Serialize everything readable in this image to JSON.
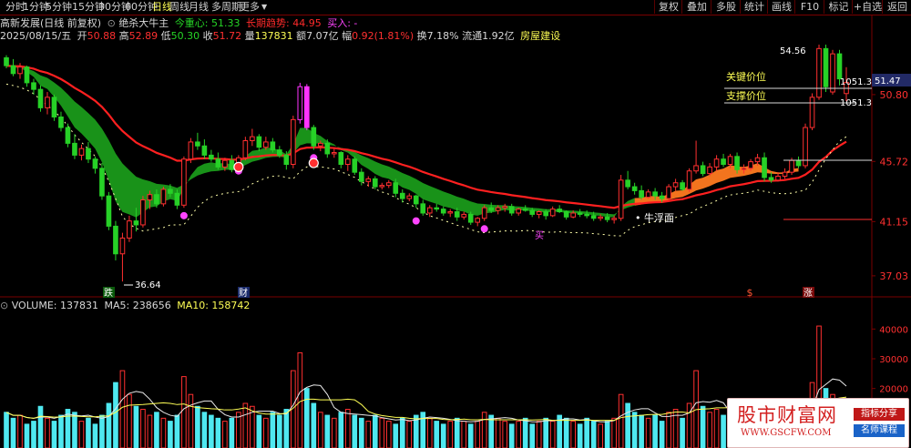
{
  "colors": {
    "up": "#ff3030",
    "down": "#27d127",
    "pink": "#ff33ff",
    "cloud": "#1a9a1a",
    "orange": "#ff7a20",
    "redLine": "#ff2020",
    "cyan": "#4fe8f0",
    "yellow": "#ffff55"
  },
  "topbar": {
    "tabs": [
      "分时",
      "1分钟",
      "5分钟",
      "15分钟",
      "30分钟",
      "60分钟",
      "日线",
      "周线",
      "月线",
      "多周期",
      "更多"
    ],
    "active_tab": "日线",
    "more_icon": "caret-down-icon",
    "right_buttons": [
      "复权",
      "叠加",
      "多股",
      "统计",
      "画线",
      "F10",
      "标记",
      "+自选",
      "返回"
    ]
  },
  "info": {
    "stock_name": "高新发展(日线 前复权)",
    "indicator_name": "绝杀大牛主",
    "today_center_label": "今重心: ",
    "today_center": "51.33",
    "long_trend_label": "长期趋势: ",
    "long_trend": "44.95",
    "buy_label": "买入: ",
    "buy_value": "-",
    "date": "2025/08/15/五",
    "open_label": "开",
    "open": "50.88",
    "high_label": "高",
    "high": "52.89",
    "low_label": "低",
    "low": "50.30",
    "close_label": "收",
    "close": "51.72",
    "volume_label": "量",
    "volume": "137831",
    "amount_label": "额",
    "amount": "7.07亿",
    "change_label": "幅",
    "change": "0.92(1.81%)",
    "turnover_label": "换",
    "turnover": "7.18%",
    "float_label": "流通",
    "float": "1.92亿",
    "sector": "房屋建设"
  },
  "price_axis": {
    "labels": [
      "50.80",
      "45.72",
      "41.15",
      "37.03"
    ],
    "current_price": "51.47"
  },
  "annotations": {
    "key_price": "关键价位",
    "support_price": "支撑价位",
    "key_value": "1051.3",
    "support_value": "1051.3",
    "niufu": "牛浮面",
    "high_mark": "54.56",
    "low_mark": "36.64",
    "mark_die": "跌",
    "mark_cai": "财",
    "mark_dollar": "$",
    "mark_zhang": "涨",
    "mark_mai": "买"
  },
  "volume": {
    "title": "VOLUME: ",
    "value": "137831",
    "ma5_label": "MA5: ",
    "ma5": "238656",
    "ma10_label": "MA10: ",
    "ma10": "158742",
    "axis_labels": [
      "40000",
      "30000",
      "20000"
    ]
  },
  "watermark": {
    "title": "股市财富网",
    "url": "WWW.GSCFW.COM",
    "badge1": "指标分享",
    "badge2": "名师课程"
  },
  "chart_data": {
    "type": "candlestick",
    "ylim": [
      35.5,
      55.5
    ],
    "yticks": [
      50.8,
      45.72,
      41.15,
      37.03
    ],
    "ohlc": [
      [
        53.6,
        53.8,
        52.8,
        53.0
      ],
      [
        53.0,
        53.5,
        52.2,
        52.4
      ],
      [
        52.4,
        53.2,
        52.0,
        52.9
      ],
      [
        52.9,
        53.0,
        51.4,
        51.7
      ],
      [
        51.7,
        52.0,
        50.8,
        51.2
      ],
      [
        51.2,
        51.5,
        49.5,
        49.8
      ],
      [
        49.8,
        51.0,
        49.3,
        50.6
      ],
      [
        50.6,
        50.8,
        48.8,
        49.1
      ],
      [
        49.1,
        49.5,
        48.0,
        48.3
      ],
      [
        48.3,
        48.6,
        46.8,
        47.1
      ],
      [
        47.1,
        47.8,
        45.9,
        46.2
      ],
      [
        46.2,
        47.0,
        45.8,
        46.7
      ],
      [
        46.7,
        47.2,
        45.6,
        45.9
      ],
      [
        45.9,
        46.1,
        44.8,
        45.2
      ],
      [
        45.2,
        45.6,
        42.8,
        43.1
      ],
      [
        43.1,
        43.4,
        40.5,
        40.8
      ],
      [
        40.8,
        41.2,
        38.2,
        38.7
      ],
      [
        38.7,
        40.3,
        36.6,
        39.9
      ],
      [
        39.9,
        41.6,
        39.6,
        41.2
      ],
      [
        41.2,
        42.2,
        40.4,
        40.9
      ],
      [
        40.9,
        43.1,
        40.7,
        42.8
      ],
      [
        42.8,
        43.5,
        42.1,
        43.2
      ],
      [
        43.2,
        43.6,
        42.2,
        42.5
      ],
      [
        42.5,
        43.8,
        42.3,
        43.6
      ],
      [
        43.6,
        44.0,
        43.0,
        43.3
      ],
      [
        43.3,
        43.6,
        42.1,
        42.4
      ],
      [
        42.4,
        46.1,
        42.2,
        45.9
      ],
      [
        45.9,
        47.5,
        45.6,
        47.2
      ],
      [
        47.2,
        47.9,
        46.6,
        46.9
      ],
      [
        46.9,
        47.4,
        45.9,
        46.2
      ],
      [
        46.2,
        46.6,
        45.7,
        45.9
      ],
      [
        45.9,
        46.4,
        45.1,
        45.3
      ],
      [
        45.3,
        46.0,
        45.0,
        45.8
      ],
      [
        45.8,
        46.2,
        44.9,
        45.1
      ],
      [
        45.1,
        46.2,
        44.9,
        46.0
      ],
      [
        46.0,
        47.6,
        45.8,
        47.3
      ],
      [
        47.3,
        48.2,
        46.9,
        47.6
      ],
      [
        47.6,
        47.8,
        46.5,
        46.8
      ],
      [
        46.8,
        47.6,
        46.6,
        47.2
      ],
      [
        47.2,
        47.5,
        46.4,
        46.6
      ],
      [
        46.6,
        46.9,
        46.0,
        46.2
      ],
      [
        46.2,
        46.5,
        45.1,
        45.5
      ],
      [
        45.5,
        49.2,
        45.2,
        48.9
      ],
      [
        48.9,
        51.7,
        48.6,
        51.4
      ],
      [
        51.4,
        51.6,
        48.1,
        48.3
      ],
      [
        48.3,
        48.5,
        46.6,
        46.9
      ],
      [
        46.9,
        47.3,
        46.5,
        47.1
      ],
      [
        47.1,
        47.4,
        46.0,
        46.3
      ],
      [
        46.3,
        46.7,
        46.0,
        46.4
      ],
      [
        46.4,
        46.5,
        45.2,
        45.5
      ],
      [
        45.5,
        46.2,
        45.0,
        45.9
      ],
      [
        45.9,
        46.1,
        44.7,
        44.9
      ],
      [
        44.9,
        45.2,
        43.9,
        44.2
      ],
      [
        44.2,
        44.6,
        43.8,
        44.4
      ],
      [
        44.4,
        44.6,
        43.6,
        43.8
      ],
      [
        43.8,
        44.1,
        43.6,
        43.9
      ],
      [
        43.9,
        44.3,
        43.7,
        44.1
      ],
      [
        44.1,
        44.4,
        43.0,
        43.3
      ],
      [
        43.3,
        43.6,
        42.6,
        42.9
      ],
      [
        42.9,
        43.3,
        42.7,
        43.1
      ],
      [
        43.1,
        43.2,
        42.2,
        42.5
      ],
      [
        42.5,
        42.8,
        41.6,
        41.8
      ],
      [
        41.8,
        42.4,
        41.5,
        42.2
      ],
      [
        42.2,
        42.5,
        41.9,
        42.1
      ],
      [
        42.1,
        42.3,
        41.6,
        41.8
      ],
      [
        41.8,
        42.1,
        41.5,
        41.9
      ],
      [
        41.9,
        42.2,
        41.2,
        41.5
      ],
      [
        41.5,
        41.9,
        41.3,
        41.7
      ],
      [
        41.7,
        41.9,
        40.9,
        41.1
      ],
      [
        41.1,
        41.5,
        40.8,
        41.4
      ],
      [
        41.4,
        42.4,
        41.2,
        42.2
      ],
      [
        42.2,
        42.6,
        41.8,
        42.0
      ],
      [
        42.0,
        42.4,
        41.7,
        42.2
      ],
      [
        42.2,
        42.5,
        41.9,
        42.3
      ],
      [
        42.3,
        42.5,
        41.6,
        41.8
      ],
      [
        41.8,
        42.2,
        41.6,
        42.1
      ],
      [
        42.1,
        42.4,
        41.9,
        42.0
      ],
      [
        42.0,
        42.2,
        41.5,
        41.7
      ],
      [
        41.7,
        42.0,
        41.4,
        41.9
      ],
      [
        41.9,
        42.1,
        41.3,
        41.6
      ],
      [
        41.6,
        42.3,
        41.5,
        42.1
      ],
      [
        42.1,
        42.4,
        41.8,
        41.9
      ],
      [
        41.9,
        42.0,
        41.3,
        41.5
      ],
      [
        41.5,
        42.0,
        41.4,
        41.8
      ],
      [
        41.8,
        42.1,
        41.5,
        41.7
      ],
      [
        41.7,
        42.0,
        41.4,
        41.6
      ],
      [
        41.6,
        41.9,
        41.2,
        41.4
      ],
      [
        41.4,
        41.7,
        41.2,
        41.5
      ],
      [
        41.5,
        41.8,
        41.1,
        41.3
      ],
      [
        41.3,
        41.6,
        41.0,
        41.4
      ],
      [
        41.4,
        44.7,
        41.2,
        44.3
      ],
      [
        44.3,
        45.0,
        43.6,
        43.8
      ],
      [
        43.8,
        44.1,
        43.2,
        43.5
      ],
      [
        43.5,
        43.9,
        42.8,
        43.0
      ],
      [
        43.0,
        43.6,
        42.9,
        43.4
      ],
      [
        43.4,
        43.7,
        42.8,
        43.1
      ],
      [
        43.1,
        43.4,
        42.6,
        42.9
      ],
      [
        42.9,
        44.0,
        42.8,
        43.8
      ],
      [
        43.8,
        44.4,
        43.5,
        44.1
      ],
      [
        44.1,
        44.3,
        43.5,
        43.6
      ],
      [
        43.6,
        45.2,
        43.4,
        45.0
      ],
      [
        45.0,
        47.3,
        44.8,
        45.4
      ],
      [
        45.4,
        45.7,
        44.6,
        44.8
      ],
      [
        44.8,
        45.6,
        44.6,
        45.3
      ],
      [
        45.3,
        46.2,
        45.0,
        45.9
      ],
      [
        45.9,
        46.3,
        45.3,
        45.5
      ],
      [
        45.5,
        46.3,
        45.2,
        46.1
      ],
      [
        46.1,
        46.4,
        44.8,
        45.1
      ],
      [
        45.1,
        45.5,
        44.8,
        45.2
      ],
      [
        45.2,
        45.9,
        45.0,
        45.7
      ],
      [
        45.7,
        46.3,
        45.4,
        46.0
      ],
      [
        46.0,
        46.4,
        44.2,
        44.5
      ],
      [
        44.5,
        44.9,
        44.1,
        44.3
      ],
      [
        44.3,
        44.9,
        44.2,
        44.6
      ],
      [
        44.6,
        45.2,
        44.4,
        44.9
      ],
      [
        44.9,
        46.0,
        44.7,
        45.8
      ],
      [
        45.8,
        46.1,
        45.2,
        45.4
      ],
      [
        45.4,
        48.6,
        45.2,
        48.3
      ],
      [
        48.3,
        50.9,
        48.1,
        50.6
      ],
      [
        50.6,
        54.6,
        50.4,
        54.3
      ],
      [
        54.3,
        54.6,
        51.0,
        51.4
      ],
      [
        51.0,
        54.2,
        50.8,
        53.9
      ],
      [
        53.9,
        54.2,
        51.5,
        52.0
      ],
      [
        50.88,
        52.89,
        50.3,
        51.72
      ]
    ],
    "volume": [
      12,
      10,
      11,
      8,
      9,
      14,
      10,
      9,
      11,
      13,
      12,
      9,
      10,
      8,
      11,
      15,
      22,
      26,
      18,
      14,
      13,
      11,
      12,
      10,
      9,
      11,
      24,
      18,
      14,
      12,
      11,
      10,
      9,
      10,
      12,
      15,
      14,
      11,
      10,
      12,
      11,
      13,
      26,
      32,
      20,
      15,
      12,
      11,
      10,
      12,
      13,
      11,
      10,
      9,
      11,
      10,
      9,
      8,
      10,
      9,
      11,
      12,
      10,
      9,
      8,
      9,
      10,
      9,
      8,
      9,
      12,
      11,
      10,
      9,
      8,
      9,
      10,
      8,
      9,
      10,
      9,
      11,
      10,
      9,
      8,
      10,
      9,
      8,
      9,
      10,
      18,
      15,
      12,
      11,
      10,
      11,
      9,
      12,
      13,
      10,
      15,
      26,
      14,
      12,
      13,
      11,
      10,
      12,
      11,
      10,
      12,
      9,
      8,
      9,
      10,
      11,
      9,
      15,
      22,
      41,
      20,
      18,
      13,
      12
    ],
    "volume_ylim": [
      0,
      45000
    ]
  }
}
